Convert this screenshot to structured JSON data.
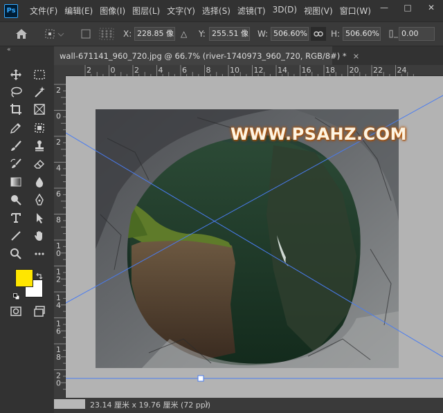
{
  "app": {
    "logo_text": "Ps",
    "menus": [
      "文件(F)",
      "编辑(E)",
      "图像(I)",
      "图层(L)",
      "文字(Y)",
      "选择(S)",
      "滤镜(T)",
      "3D(D)",
      "视图(V)",
      "窗口(W)"
    ],
    "window_controls": {
      "minimize": "—",
      "restore": "□",
      "close": "✕"
    }
  },
  "options": {
    "x_label": "X:",
    "x_value": "228.85 像",
    "delta_icon": "△",
    "y_label": "Y:",
    "y_value": "255.51 像",
    "w_label": "W:",
    "w_value": "506.60%",
    "h_label": "H:",
    "h_value": "506.60%",
    "angle_value": "0.00"
  },
  "panel_collapse": "«",
  "document": {
    "tab_title": "wall-671141_960_720.jpg @ 66.7% (river-1740973_960_720, RGB/8#) *",
    "tab_close": "×",
    "watermark": "WWW.PSAHZ.COM"
  },
  "rulers": {
    "top_ticks": [
      "2",
      "0",
      "2",
      "4",
      "6",
      "8",
      "10",
      "12",
      "14",
      "16",
      "18",
      "20",
      "22",
      "24"
    ],
    "left_ticks": [
      "2",
      "0",
      "2",
      "4",
      "6",
      "8",
      "10",
      "12",
      "14",
      "16",
      "18",
      "20"
    ]
  },
  "status": {
    "dimensions": "23.14 厘米 x 19.76 厘米 (72 ppi)",
    "arrow": "〉"
  },
  "colors": {
    "foreground": "#ffe600",
    "background": "#ffffff",
    "guide_line": "#4a7cf0",
    "canvas_gray": "#b3b3b3"
  },
  "tools": [
    "move-icon",
    "marquee-icon",
    "lasso-icon",
    "magic-wand-icon",
    "crop-icon",
    "frame-icon",
    "eyedropper-icon",
    "object-select-icon",
    "brush-icon",
    "stamp-icon",
    "history-brush-icon",
    "eraser-icon",
    "gradient-icon",
    "blur-icon",
    "dodge-icon",
    "pen-icon",
    "type-icon",
    "path-select-icon",
    "line-icon",
    "hand-icon",
    "zoom-icon",
    "more-tools-icon",
    "quick-mask-icon",
    "screen-mode-icon"
  ]
}
